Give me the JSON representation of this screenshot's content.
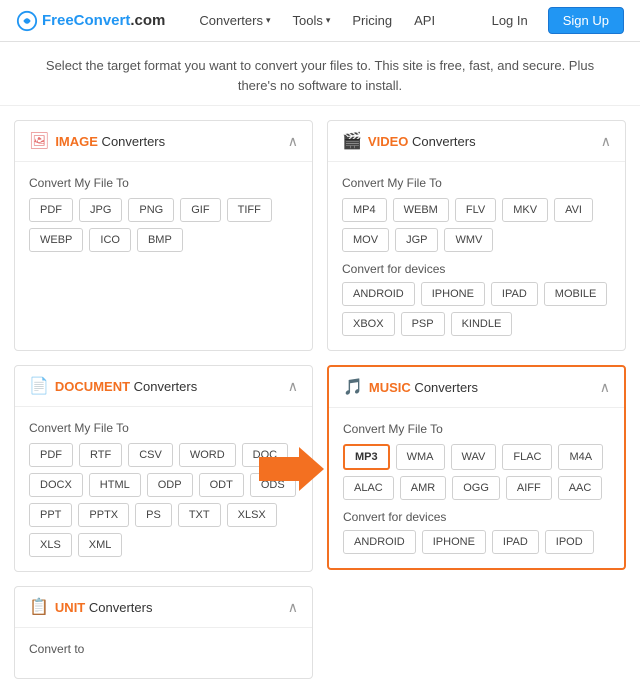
{
  "nav": {
    "logo_text": "FreeConvert",
    "logo_suffix": ".com",
    "links": [
      {
        "label": "Converters",
        "has_caret": true
      },
      {
        "label": "Tools",
        "has_caret": true
      },
      {
        "label": "Pricing",
        "has_caret": false
      },
      {
        "label": "API",
        "has_caret": false
      }
    ],
    "login_label": "Log In",
    "signup_label": "Sign Up"
  },
  "subtitle": "Select the target format you want to convert your files to. This site is free, fast, and secure. Plus\nthere's no software to install.",
  "cards": [
    {
      "id": "image",
      "category": "IMAGE",
      "rest": " Converters",
      "highlighted": false,
      "sections": [
        {
          "label": "Convert My File To",
          "formats": [
            "PDF",
            "JPG",
            "PNG",
            "GIF",
            "TIFF",
            "WEBP",
            "ICO",
            "BMP"
          ]
        }
      ]
    },
    {
      "id": "video",
      "category": "VIDEO",
      "rest": " Converters",
      "highlighted": false,
      "sections": [
        {
          "label": "Convert My File To",
          "formats": [
            "MP4",
            "WEBM",
            "FLV",
            "MKV",
            "AVI",
            "MOV",
            "JGP",
            "WMV"
          ]
        },
        {
          "label": "Convert for devices",
          "formats": [
            "ANDROID",
            "IPHONE",
            "IPAD",
            "MOBILE",
            "XBOX",
            "PSP",
            "KINDLE"
          ]
        }
      ]
    },
    {
      "id": "document",
      "category": "DOCUMENT",
      "rest": " Converters",
      "highlighted": false,
      "sections": [
        {
          "label": "Convert My File To",
          "formats": [
            "PDF",
            "RTF",
            "CSV",
            "WORD",
            "DOC",
            "DOCX",
            "HTML",
            "ODP",
            "ODT",
            "ODS",
            "PPT",
            "PPTX",
            "PS",
            "TXT",
            "XLSX",
            "XLS",
            "XML"
          ]
        }
      ]
    },
    {
      "id": "music",
      "category": "MUSIC",
      "rest": " Converters",
      "highlighted": true,
      "sections": [
        {
          "label": "Convert My File To",
          "formats": [
            "MP3",
            "WMA",
            "WAV",
            "FLAC",
            "M4A",
            "ALAC",
            "AMR",
            "OGG",
            "AIFF",
            "AAC"
          ],
          "highlighted_format": "MP3"
        },
        {
          "label": "Convert for devices",
          "formats": [
            "ANDROID",
            "IPHONE",
            "IPAD",
            "IPOD"
          ]
        }
      ]
    }
  ],
  "unit_card": {
    "category": "UNIT",
    "rest": " Converters",
    "label": "Convert to"
  }
}
